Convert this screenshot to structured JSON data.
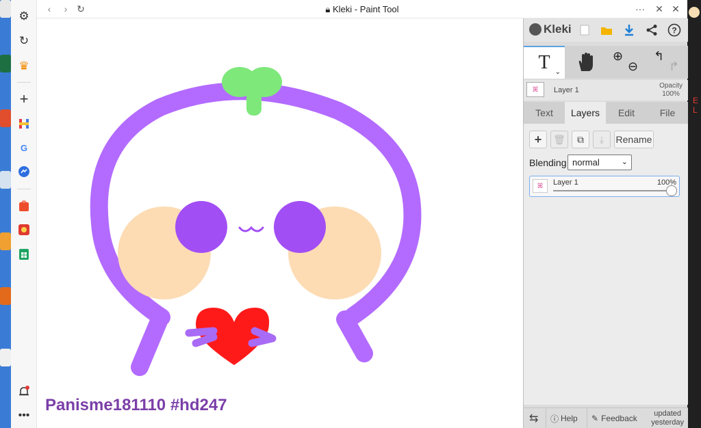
{
  "window": {
    "title": "Kleki - Paint Tool",
    "lock_icon": "lock-icon",
    "controls": [
      "ellipsis-icon",
      "pin-icon",
      "close-icon"
    ]
  },
  "browser_sidebar": {
    "icons": [
      "gear-icon",
      "history-icon",
      "crown-icon",
      "plus-icon",
      "h-app-icon",
      "google-icon",
      "messenger-icon",
      "shopee-icon",
      "game-icon",
      "sheets-icon",
      "bell-icon",
      "more-icon"
    ]
  },
  "canvas": {
    "signature": "Panisme181110 #hd247",
    "colors": {
      "outline": "#b36bff",
      "sprout": "#7ee87a",
      "cheek": "#fddcb4",
      "eye": "#a24ef5",
      "heart": "#ff1a1a"
    }
  },
  "panel": {
    "logo": "Kleki",
    "header_icons": [
      "new-file-icon",
      "folder-icon",
      "download-icon",
      "share-icon",
      "help-icon"
    ],
    "tools": {
      "text_tool": "T",
      "hand_tool": "hand-icon",
      "zoom_in": "zoom-in-icon",
      "zoom_out": "zoom-out-icon",
      "undo": "undo-icon",
      "redo": "redo-icon"
    },
    "current_layer": {
      "name": "Layer 1",
      "opacity_label": "Opacity",
      "opacity_value": "100%"
    },
    "tabs": [
      {
        "label": "Text",
        "active": false
      },
      {
        "label": "Layers",
        "active": true
      },
      {
        "label": "Edit",
        "active": false
      },
      {
        "label": "File",
        "active": false
      }
    ],
    "layers": {
      "rename_label": "Rename",
      "blending_label": "Blending",
      "blending_value": "normal",
      "items": [
        {
          "name": "Layer 1",
          "opacity": "100%"
        }
      ]
    },
    "footer": {
      "help": "Help",
      "feedback": "Feedback",
      "updated_line1": "updated",
      "updated_line2": "yesterday"
    }
  }
}
